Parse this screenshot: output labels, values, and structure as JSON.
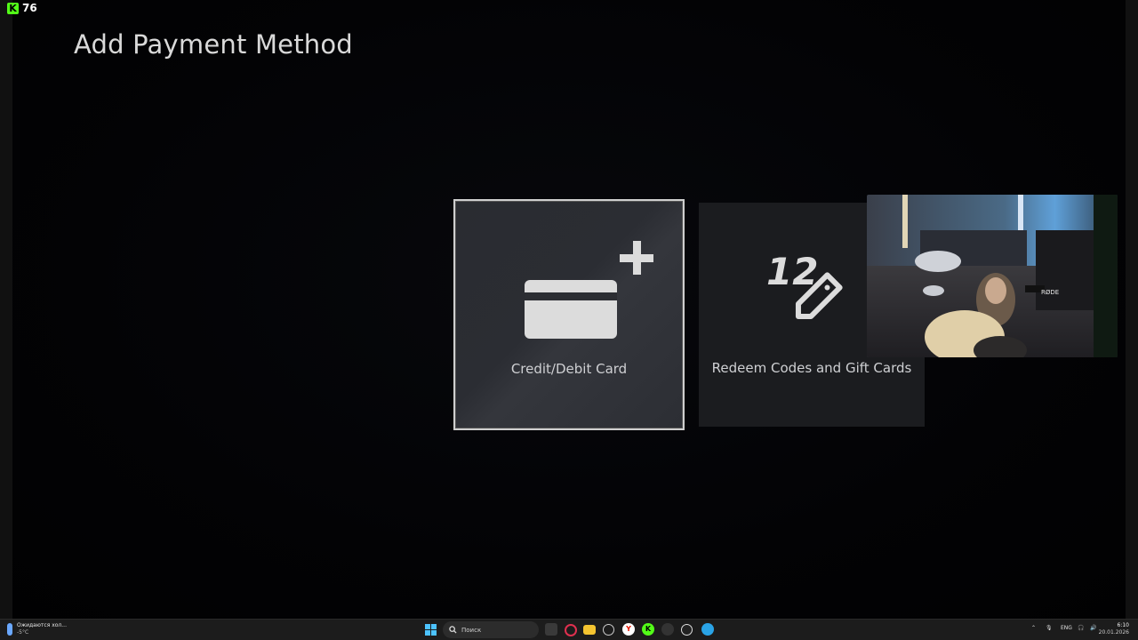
{
  "stream_overlay": {
    "viewer_count": "76",
    "logo_letter": "K"
  },
  "page": {
    "title": "Add Payment Method"
  },
  "tiles": [
    {
      "label": "Credit/Debit Card",
      "icon": "credit-card-plus-icon",
      "focused": true
    },
    {
      "label": "Redeem Codes and Gift Cards",
      "icon": "code-tag-icon",
      "icon_text": "12",
      "focused": false
    }
  ],
  "webcam": {
    "mic_brand": "RØDE"
  },
  "taskbar": {
    "weather": {
      "line1": "Ожидаются хол...",
      "line2": "-5°C"
    },
    "search_placeholder": "Поиск",
    "apps": [
      {
        "name": "file-view-icon",
        "color": "#3a3a3a"
      },
      {
        "name": "opera-gx-icon",
        "color": "#e0304f"
      },
      {
        "name": "file-explorer-icon",
        "color": "#f4c430"
      },
      {
        "name": "emoji-app-icon",
        "color": "#444"
      },
      {
        "name": "yandex-browser-icon",
        "color": "#ffffff"
      },
      {
        "name": "kick-app-icon",
        "color": "#53fc18"
      },
      {
        "name": "edge-app-icon",
        "color": "#333"
      },
      {
        "name": "obs-icon",
        "color": "#222"
      },
      {
        "name": "telegram-icon",
        "color": "#2aa3e6"
      }
    ],
    "tray": {
      "language": "ENG",
      "time": "6:10",
      "date": "20.01.2026"
    },
    "accent": "#4cc2ff"
  }
}
